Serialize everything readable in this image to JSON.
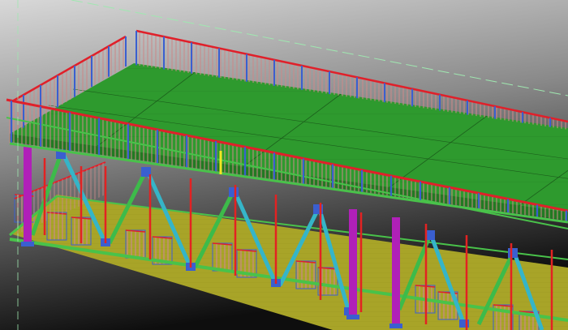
{
  "viewport": {
    "label": "",
    "colors": {
      "bg_top": "#d8d8d8",
      "bg_mid": "#8a8a8a",
      "bg_bottom": "#0e0e0e",
      "deck": "#2e9a2e",
      "deck_shade": "#227a22",
      "lower_deck": "#a8a428",
      "handrail": "#e0202a",
      "post": "#3a5fd0",
      "infill": "#c98a8a",
      "beam": "#49c24a",
      "column": "#b020b8",
      "brace": "#35b5c8",
      "brace_green": "#3dbb4a",
      "post_red": "#e32222",
      "axis_line": "#9fe8b0",
      "highlight": "#f5e623"
    }
  }
}
